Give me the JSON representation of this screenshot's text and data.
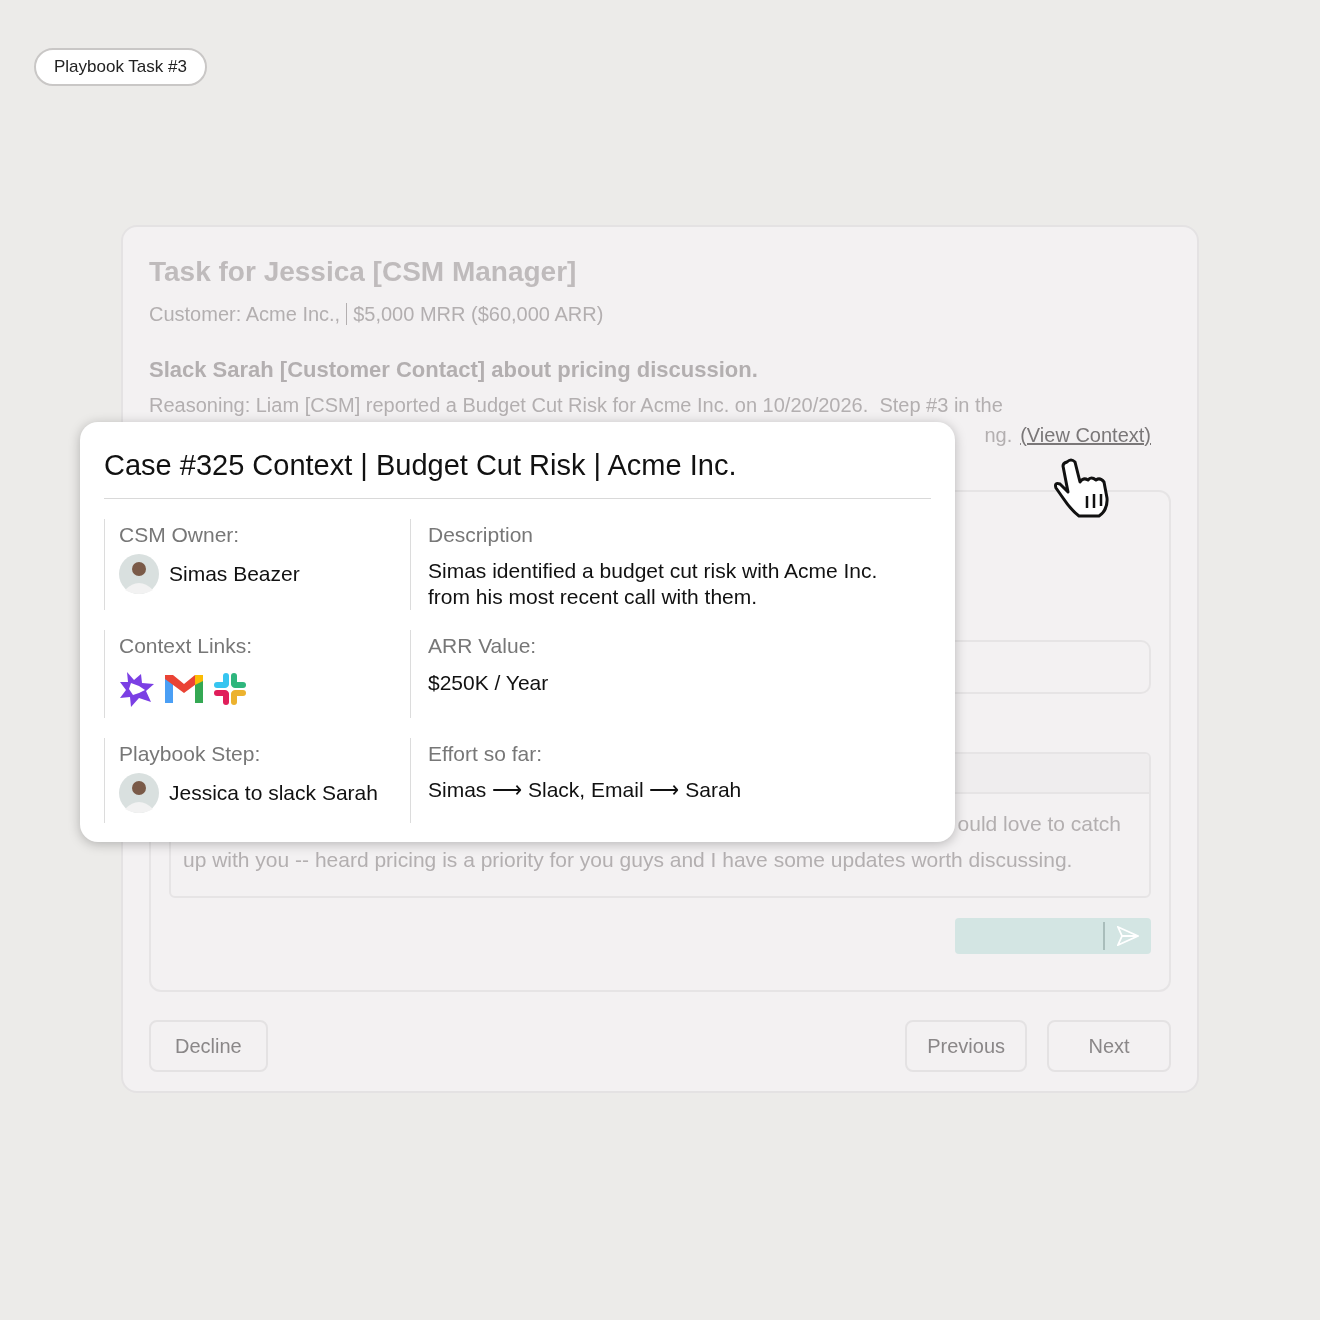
{
  "badge": "Playbook Task #3",
  "task": {
    "title": "Task for Jessica [CSM Manager]",
    "customer": "Customer: Acme Inc.,",
    "revenue": "$5,000 MRR ($60,000 ARR)",
    "action": "Slack Sarah [Customer Contact] about pricing discussion.",
    "reasoning_line_1": "Reasoning: Liam [CSM] reported a Budget Cut Risk for Acme Inc. on 10/20/2026.  Step #3 in the",
    "reasoning_line_2": "ng.",
    "link": "(View Context)"
  },
  "message": {
    "line_1": "ould love to catch",
    "line_2": "up with you -- heard pricing is a priority for you guys and I have some updates worth discussing."
  },
  "buttons": {
    "decline": "Decline",
    "previous": "Previous",
    "next": "Next"
  },
  "popup": {
    "title": "Case #325 Context | Budget Cut Risk | Acme Inc.",
    "rows": [
      {
        "left": {
          "label": "CSM Owner:",
          "kind": "person",
          "value": "Simas Beazer"
        },
        "right": {
          "label": "Description",
          "value": "Simas identified a budget cut risk with Acme Inc. from his most recent call with them."
        }
      },
      {
        "left": {
          "label": "Context Links:",
          "kind": "links"
        },
        "right": {
          "label": "ARR Value:",
          "value": "$250K / Year"
        }
      },
      {
        "left": {
          "label": "Playbook Step:",
          "kind": "person",
          "value": "Jessica to slack Sarah"
        },
        "right": {
          "label": "Effort so far:",
          "value": "Simas ⟶ Slack, Email ⟶ Sarah"
        }
      }
    ]
  }
}
